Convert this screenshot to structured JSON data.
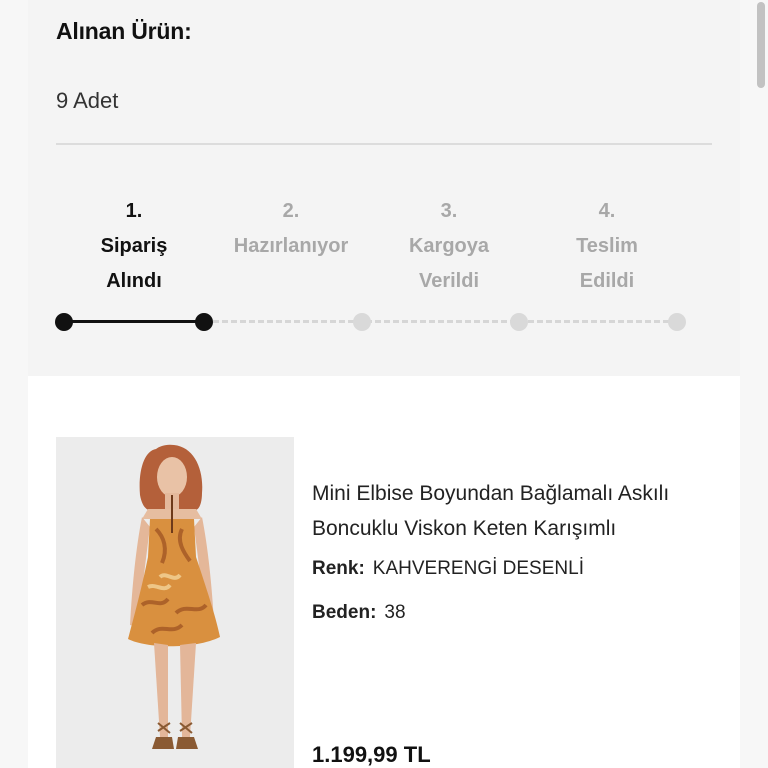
{
  "order": {
    "bought_label": "Alınan Ürün:",
    "quantity_text": "9 Adet"
  },
  "progress": {
    "current_step": 1,
    "steps": [
      {
        "num": "1.",
        "name": "Sipariş\nAlındı",
        "status": "done"
      },
      {
        "num": "2.",
        "name": "Hazırlanıyor",
        "status": "pending"
      },
      {
        "num": "3.",
        "name": "Kargoya\nVerildi",
        "status": "pending"
      },
      {
        "num": "4.",
        "name": "Teslim\nEdildi",
        "status": "pending"
      }
    ]
  },
  "product": {
    "title": "Mini Elbise Boyundan Bağlamalı Askılı Boncuklu Viskon Keten Karışımlı",
    "color_label": "Renk:",
    "color_value": "KAHVERENGİ DESENLİ",
    "size_label": "Beden:",
    "size_value": "38",
    "price": "1.199,99 TL",
    "image_icon": "dress-photo"
  },
  "colors": {
    "accent": "#111111",
    "inactive": "#a8a8a8",
    "dress": "#d9903f"
  }
}
